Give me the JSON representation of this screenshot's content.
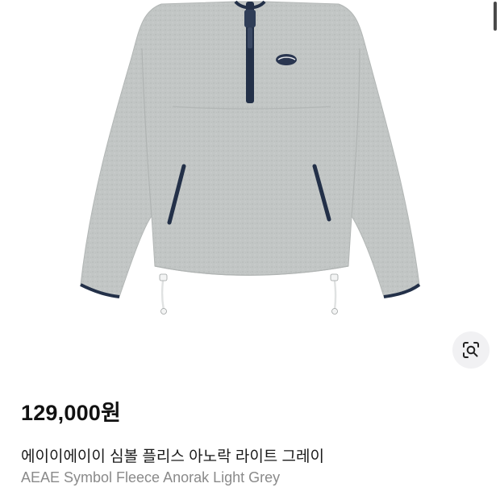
{
  "product": {
    "image_alt": "Grey fleece anorak pullover with navy zipper and trim",
    "price": "129,000원",
    "name_korean": "에이이에이이 심볼 플리스 아노락 라이트 그레이",
    "name_english": "AEAE Symbol Fleece Anorak Light Grey"
  },
  "icons": {
    "lens": "lens-search-icon",
    "scroll": "scroll-indicator"
  },
  "colors": {
    "fleece": "#c2c6c5",
    "trim": "#233048",
    "price_text": "#111111",
    "english_name_text": "#8a8a8a",
    "lens_button_bg": "#f1f1f3"
  }
}
